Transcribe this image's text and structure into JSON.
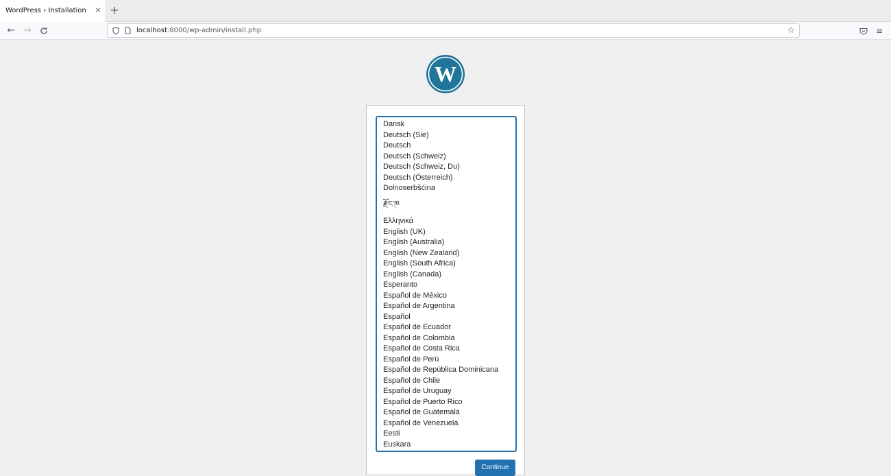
{
  "browser": {
    "tab_title": "WordPress › Installation",
    "tab_close": "×",
    "new_tab": "+",
    "url_host": "localhost",
    "url_path": ":8000/wp-admin/install.php"
  },
  "installer": {
    "languages": [
      "Dansk",
      "Deutsch (Sie)",
      "Deutsch",
      "Deutsch (Schweiz)",
      "Deutsch (Schweiz, Du)",
      "Deutsch (Österreich)",
      "Dolnoserbšćina",
      "རྫོང་ཁ",
      "Ελληνικά",
      "English (UK)",
      "English (Australia)",
      "English (New Zealand)",
      "English (South Africa)",
      "English (Canada)",
      "Esperanto",
      "Español de México",
      "Español de Argentina",
      "Español",
      "Español de Ecuador",
      "Español de Colombia",
      "Español de Costa Rica",
      "Español de Perú",
      "Español de República Dominicana",
      "Español de Chile",
      "Español de Uruguay",
      "Español de Puerto Rico",
      "Español de Guatemala",
      "Español de Venezuela",
      "Eesti",
      "Euskara"
    ],
    "continue_label": "Continue"
  },
  "colors": {
    "wp_blue": "#2271b1",
    "logo_blue": "#21759b",
    "page_bg": "#f0f0f1"
  },
  "icons": {
    "back": "arrow-left-icon",
    "forward": "arrow-right-icon",
    "reload": "reload-icon",
    "shield": "shield-icon",
    "page": "page-icon",
    "bookmark": "star-icon",
    "pocket": "pocket-icon",
    "menu": "hamburger-menu-icon"
  }
}
